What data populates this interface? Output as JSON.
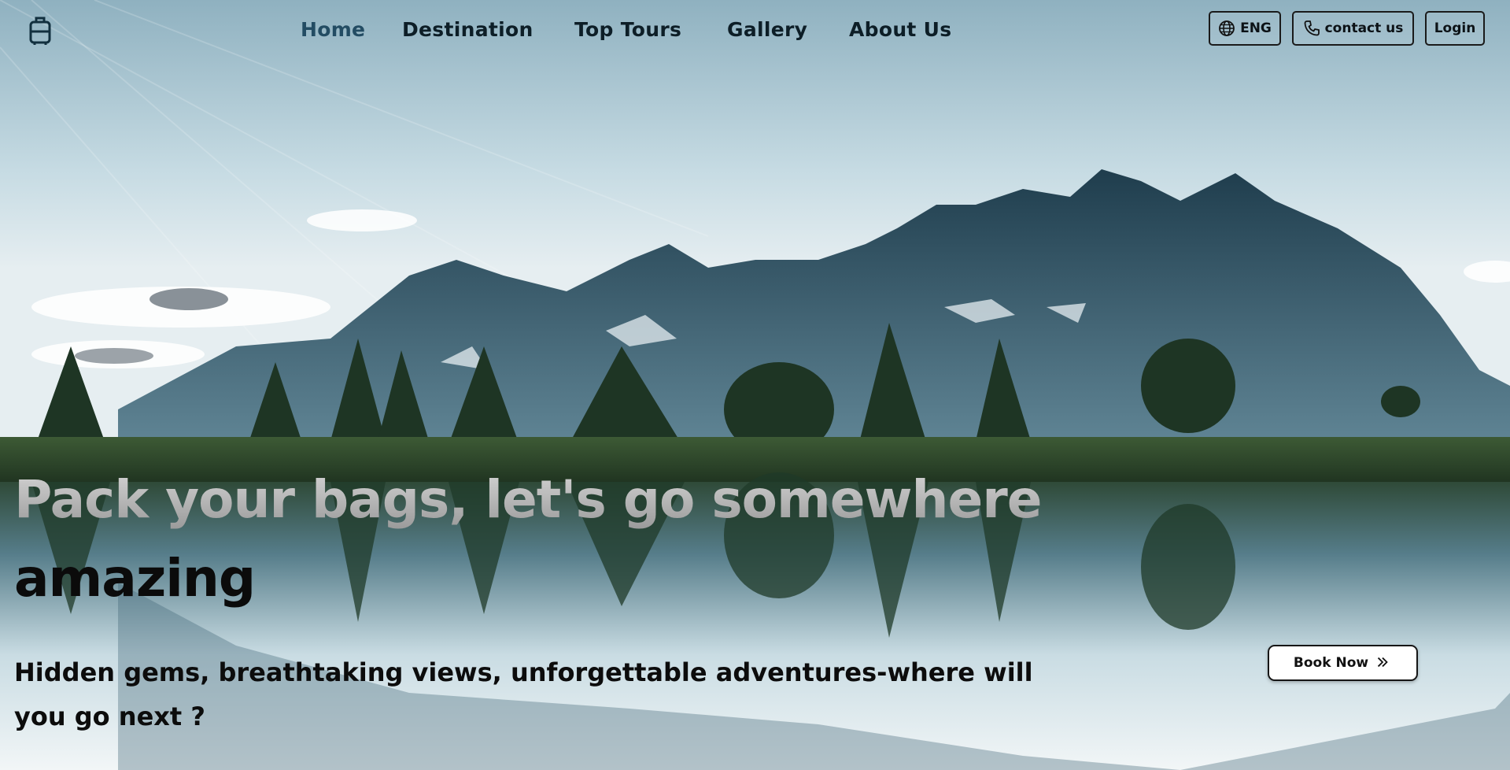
{
  "nav": {
    "items": [
      {
        "label": "Home",
        "active": true
      },
      {
        "label": "Destination"
      },
      {
        "label": "Top Tours"
      },
      {
        "label": "Gallery"
      },
      {
        "label": "About Us"
      }
    ]
  },
  "header_actions": {
    "language_label": "ENG",
    "language_icon": "globe-icon",
    "contact_label": "contact us",
    "contact_icon": "phone-icon",
    "login_label": "Login"
  },
  "logo_icon": "luggage-icon",
  "hero": {
    "headline_line1": "Pack your bags, let's go somewhere",
    "headline_line2": "amazing",
    "subtitle_line1": "Hidden gems, breathtaking views, unforgettable adventures-where will",
    "subtitle_line2": "you go next ?",
    "cta_label": "Book Now",
    "cta_icon": "double-chevron-right-icon"
  },
  "colors": {
    "nav_active": "#234c63",
    "nav_text": "#0d1e27",
    "headline_gray": "#b0b0b0",
    "text_dark": "#0b0b0b",
    "button_bg": "#ffffff"
  }
}
